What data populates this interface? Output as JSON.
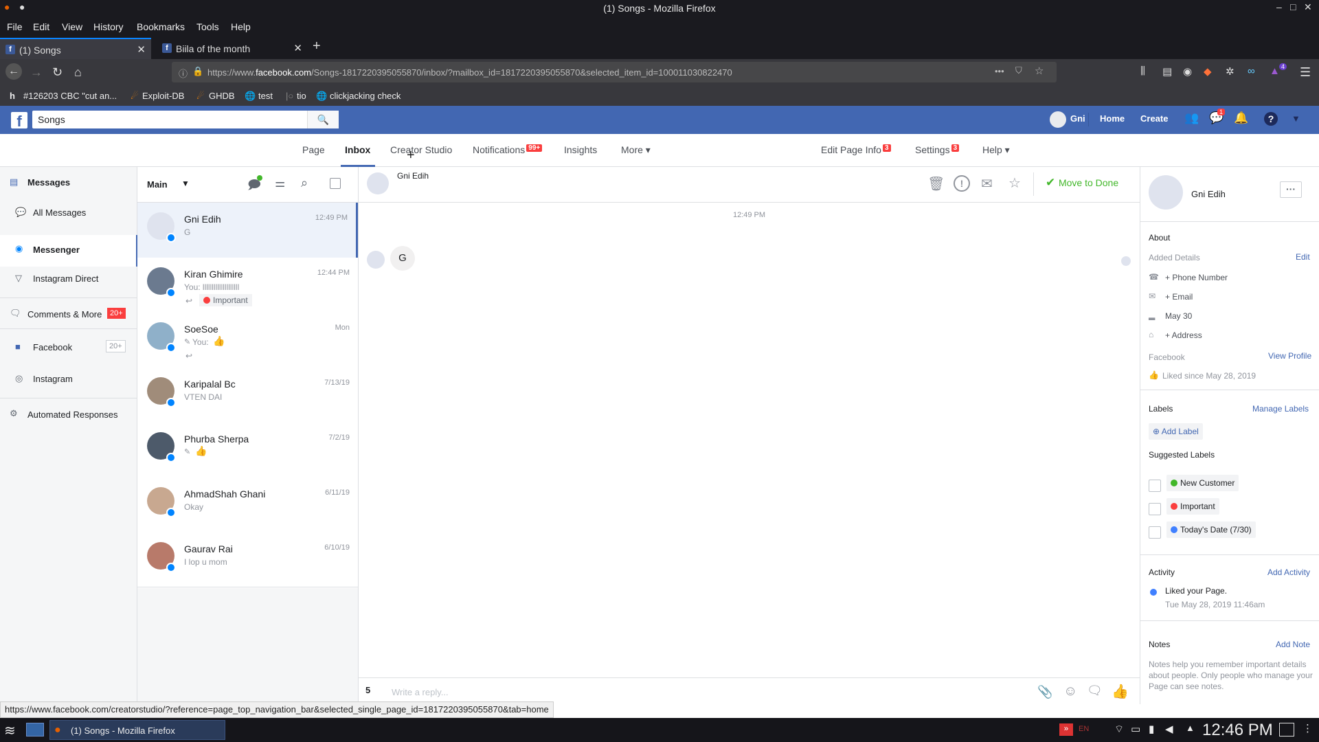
{
  "window": {
    "title": "(1) Songs - Mozilla Firefox"
  },
  "menu": [
    "File",
    "Edit",
    "View",
    "History",
    "Bookmarks",
    "Tools",
    "Help"
  ],
  "tabs": [
    {
      "label": "(1) Songs",
      "active": true
    },
    {
      "label": "Biila of the month",
      "active": false
    }
  ],
  "url": {
    "pre": "https://www.",
    "domain": "facebook.com",
    "path": "/Songs-1817220395055870/inbox/?mailbox_id=1817220395055870&selected_item_id=100011030822470"
  },
  "bookmarks": [
    "#126203 CBC \"cut an...",
    "Exploit-DB",
    "GHDB",
    "test",
    "tio",
    "clickjacking check"
  ],
  "fb": {
    "search_value": "Songs",
    "user": "Gni",
    "home": "Home",
    "create": "Create",
    "messenger_badge": "1"
  },
  "pagenav": {
    "page": "Page",
    "inbox": "Inbox",
    "creator_studio": "Creator Studio",
    "notifications": "Notifications",
    "notifications_badge": "99+",
    "insights": "Insights",
    "more": "More ▾",
    "edit_page_info": "Edit Page Info",
    "edit_badge": "3",
    "settings": "Settings",
    "settings_badge": "3",
    "help": "Help ▾"
  },
  "leftnav": {
    "messages": "Messages",
    "all_messages": "All Messages",
    "messenger": "Messenger",
    "instagram_direct": "Instagram Direct",
    "comments_more": "Comments & More",
    "comments_badge": "20+",
    "facebook": "Facebook",
    "facebook_badge": "20+",
    "instagram": "Instagram",
    "automated": "Automated Responses"
  },
  "convlist": {
    "filter": "Main",
    "items": [
      {
        "name": "Gni Edih",
        "time": "12:49 PM",
        "snippet": "G"
      },
      {
        "name": "Kiran Ghimire",
        "time": "12:44 PM",
        "snippet": "You: llllllllllllllllllll",
        "label": "Important"
      },
      {
        "name": "SoeSoe",
        "time": "Mon",
        "snippet": "You:"
      },
      {
        "name": "Karipalal Bc",
        "time": "7/13/19",
        "snippet": "VTEN DAI"
      },
      {
        "name": "Phurba Sherpa",
        "time": "7/2/19",
        "snippet": ""
      },
      {
        "name": "AhmadShah Ghani",
        "time": "6/11/19",
        "snippet": "Okay"
      },
      {
        "name": "Gaurav Rai",
        "time": "6/10/19",
        "snippet": "I lop u mom"
      }
    ]
  },
  "chat": {
    "contact": "Gni Edih",
    "move_to_done": "Move to Done",
    "timestamp": "12:49 PM",
    "message": "G",
    "reply_placeholder": "Write a reply..."
  },
  "profile": {
    "name": "Gni Edih",
    "about": "About",
    "added_details": "Added Details",
    "edit": "Edit",
    "phone": "+ Phone Number",
    "email": "+ Email",
    "birthday": "May 30",
    "address": "+ Address",
    "facebook": "Facebook",
    "view_profile": "View Profile",
    "liked_since": "Liked since May 28, 2019",
    "labels": "Labels",
    "manage_labels": "Manage Labels",
    "add_label": "Add Label",
    "suggested_labels": "Suggested Labels",
    "suggested": [
      "New Customer",
      "Important",
      "Today's Date (7/30)"
    ],
    "activity": "Activity",
    "add_activity": "Add Activity",
    "activity_text": "Liked your Page.",
    "activity_time": "Tue May 28, 2019 11:46am",
    "notes": "Notes",
    "add_note": "Add Note",
    "notes_help": "Notes help you remember important details about people. Only people who manage your Page can see notes."
  },
  "status_url": "https://www.facebook.com/creatorstudio/?reference=page_top_navigation_bar&selected_single_page_id=1817220395055870&tab=home",
  "taskbar": {
    "window": "(1) Songs - Mozilla Firefox",
    "lang": "EN",
    "clock": "12:46 PM",
    "extension_badge": "4"
  },
  "colors": {
    "fb_blue": "#4267b2",
    "messenger_blue": "#0084ff",
    "badge_red": "#fa3e3e",
    "done_green": "#42b72a"
  }
}
